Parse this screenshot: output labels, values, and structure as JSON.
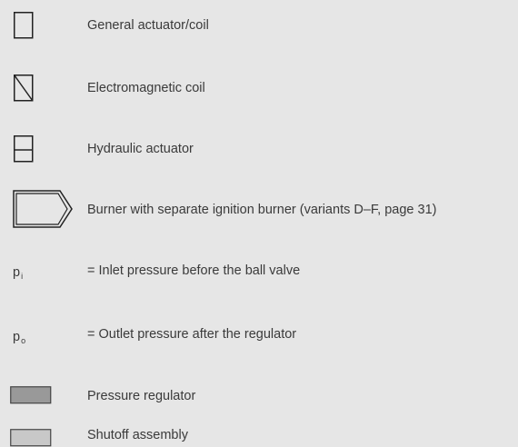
{
  "legend": {
    "items": [
      {
        "symbol": "general-actuator-coil",
        "label": "General actuator/coil"
      },
      {
        "symbol": "electromagnetic-coil",
        "label": "Electromagnetic coil"
      },
      {
        "symbol": "hydraulic-actuator",
        "label": "Hydraulic actuator"
      },
      {
        "symbol": "burner-ignition",
        "label": "Burner with separate ignition burner (variants D–F, page 31)"
      },
      {
        "symbol": "variable",
        "variable": "p",
        "subscript": "i",
        "label": "= Inlet pressure before the ball valve"
      },
      {
        "symbol": "variable",
        "variable": "p",
        "subscript": "o",
        "label": "= Outlet pressure after the regulator"
      },
      {
        "symbol": "fill-swatch",
        "color": "#999999",
        "label": "Pressure regulator"
      },
      {
        "symbol": "fill-swatch",
        "color": "#c8c8c8",
        "label": "Shutoff assembly"
      }
    ]
  }
}
